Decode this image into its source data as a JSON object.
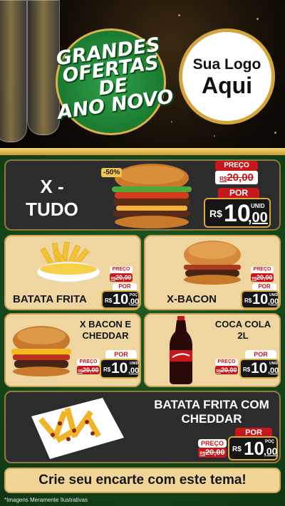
{
  "header": {
    "badge_line1": "GRANDES",
    "badge_line2": "OFERTAS DE",
    "badge_line3": "ANO NOVO",
    "logo_line1": "Sua Logo",
    "logo_line2": "Aqui"
  },
  "featured": {
    "name_line1": "X -",
    "name_line2": "TUDO",
    "discount": "-50%",
    "preco_label": "PREÇO",
    "old_currency": "R$",
    "old_price": "20,00",
    "por_label": "POR",
    "currency": "R$",
    "price_int": "10",
    "price_cents": ",00",
    "unit": "UNID"
  },
  "products": [
    {
      "name_line1": "BATATA FRITA",
      "name_line2": "",
      "preco_label": "PREÇO",
      "old_currency": "R$",
      "old_price": "20,00",
      "por_label": "POR",
      "currency": "R$",
      "price_int": "10",
      "price_cents": ",00",
      "unit": "POÇ"
    },
    {
      "name_line1": "X-BACON",
      "name_line2": "",
      "preco_label": "PREÇO",
      "old_currency": "R$",
      "old_price": "20,00",
      "por_label": "POR",
      "currency": "R$",
      "price_int": "10",
      "price_cents": ",00",
      "unit": "UNID"
    },
    {
      "name_line1": "X BACON E",
      "name_line2": "CHEDDAR",
      "preco_label": "PREÇO",
      "old_currency": "R$",
      "old_price": "20,00",
      "por_label": "POR",
      "currency": "R$",
      "price_int": "10",
      "price_cents": ",00",
      "unit": "UNID"
    },
    {
      "name_line1": "COCA COLA",
      "name_line2": "2L",
      "preco_label": "PREÇO",
      "old_currency": "R$",
      "old_price": "20,00",
      "por_label": "POR",
      "currency": "R$",
      "price_int": "10",
      "price_cents": ",00",
      "unit": "UNID"
    }
  ],
  "wide": {
    "name_line1": "BATATA FRITA COM",
    "name_line2": "CHEDDAR",
    "preco_label": "PREÇO",
    "old_currency": "R$",
    "old_price": "20,00",
    "por_label": "POR",
    "currency": "R$",
    "price_int": "10",
    "price_cents": ",00",
    "unit": "POÇ"
  },
  "footer": {
    "cta": "Crie seu encarte com este tema!",
    "note": "*Imagens Meramente Ilustrativas"
  },
  "colors": {
    "accent_red": "#c8171b",
    "gold": "#d6a93e",
    "green_bg": "#1f5a22",
    "cream": "#efd6a1"
  }
}
